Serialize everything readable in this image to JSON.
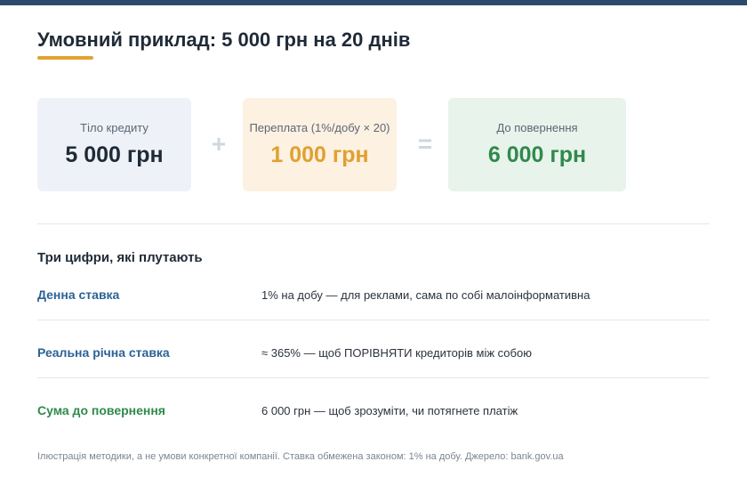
{
  "title": "Умовний приклад: 5 000 грн на 20 днів",
  "cards": {
    "principal": {
      "label": "Тіло кредиту",
      "value": "5 000 грн"
    },
    "operator_plus": "+",
    "overpayment": {
      "label": "Переплата (1%/добу × 20)",
      "value": "1 000 грн"
    },
    "operator_equals": "=",
    "total": {
      "label": "До повернення",
      "value": "6 000 грн"
    }
  },
  "section": {
    "heading": "Три цифри, які плутають",
    "rows": [
      {
        "label": "Денна ставка",
        "description": "1% на добу — для реклами, сама по собі малоінформативна"
      },
      {
        "label": "Реальна річна ставка",
        "description": "≈ 365% — щоб ПОРІВНЯТИ кредиторів між собою"
      },
      {
        "label": "Сума до повернення",
        "description": "6 000 грн — щоб зрозуміти, чи потягнете платіж"
      }
    ]
  },
  "footnote": "Ілюстрація методики, а не умови конкретної компанії. Ставка обмежена законом: 1% на добу. Джерело: bank.gov.ua",
  "colors": {
    "accent_orange": "#e0a030",
    "accent_green": "#2f8a4c",
    "accent_blue": "#2c6296",
    "header_bar": "#2c4a6e"
  }
}
